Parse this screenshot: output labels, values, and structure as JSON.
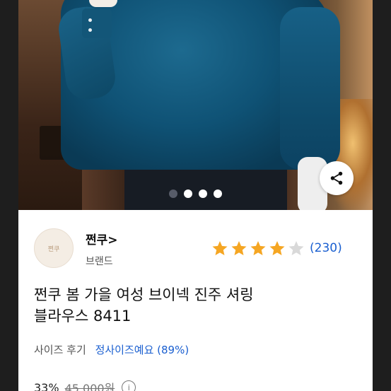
{
  "gallery": {
    "dots_total": 4,
    "active_dot": 2
  },
  "brand": {
    "name": "쩐쿠>",
    "subtitle": "브랜드",
    "logo_text": "쩐쿠"
  },
  "rating": {
    "stars": 4,
    "max_stars": 5,
    "count": "(230)"
  },
  "product": {
    "title_line1": "쩐쿠 봄 가을 여성 브이넥 진주 셔링",
    "title_line2": "블라우스 8411"
  },
  "size_review": {
    "label": "사이즈 후기",
    "value": "정사이즈예요 (89%)"
  },
  "price": {
    "discount": "33%",
    "original": "45,000원"
  },
  "colors": {
    "accent_blue": "#1a5fd0",
    "star_gold": "#f5a623",
    "star_empty": "#d9d9d9"
  },
  "icons": {
    "share": "share-icon",
    "info": "info-icon"
  }
}
